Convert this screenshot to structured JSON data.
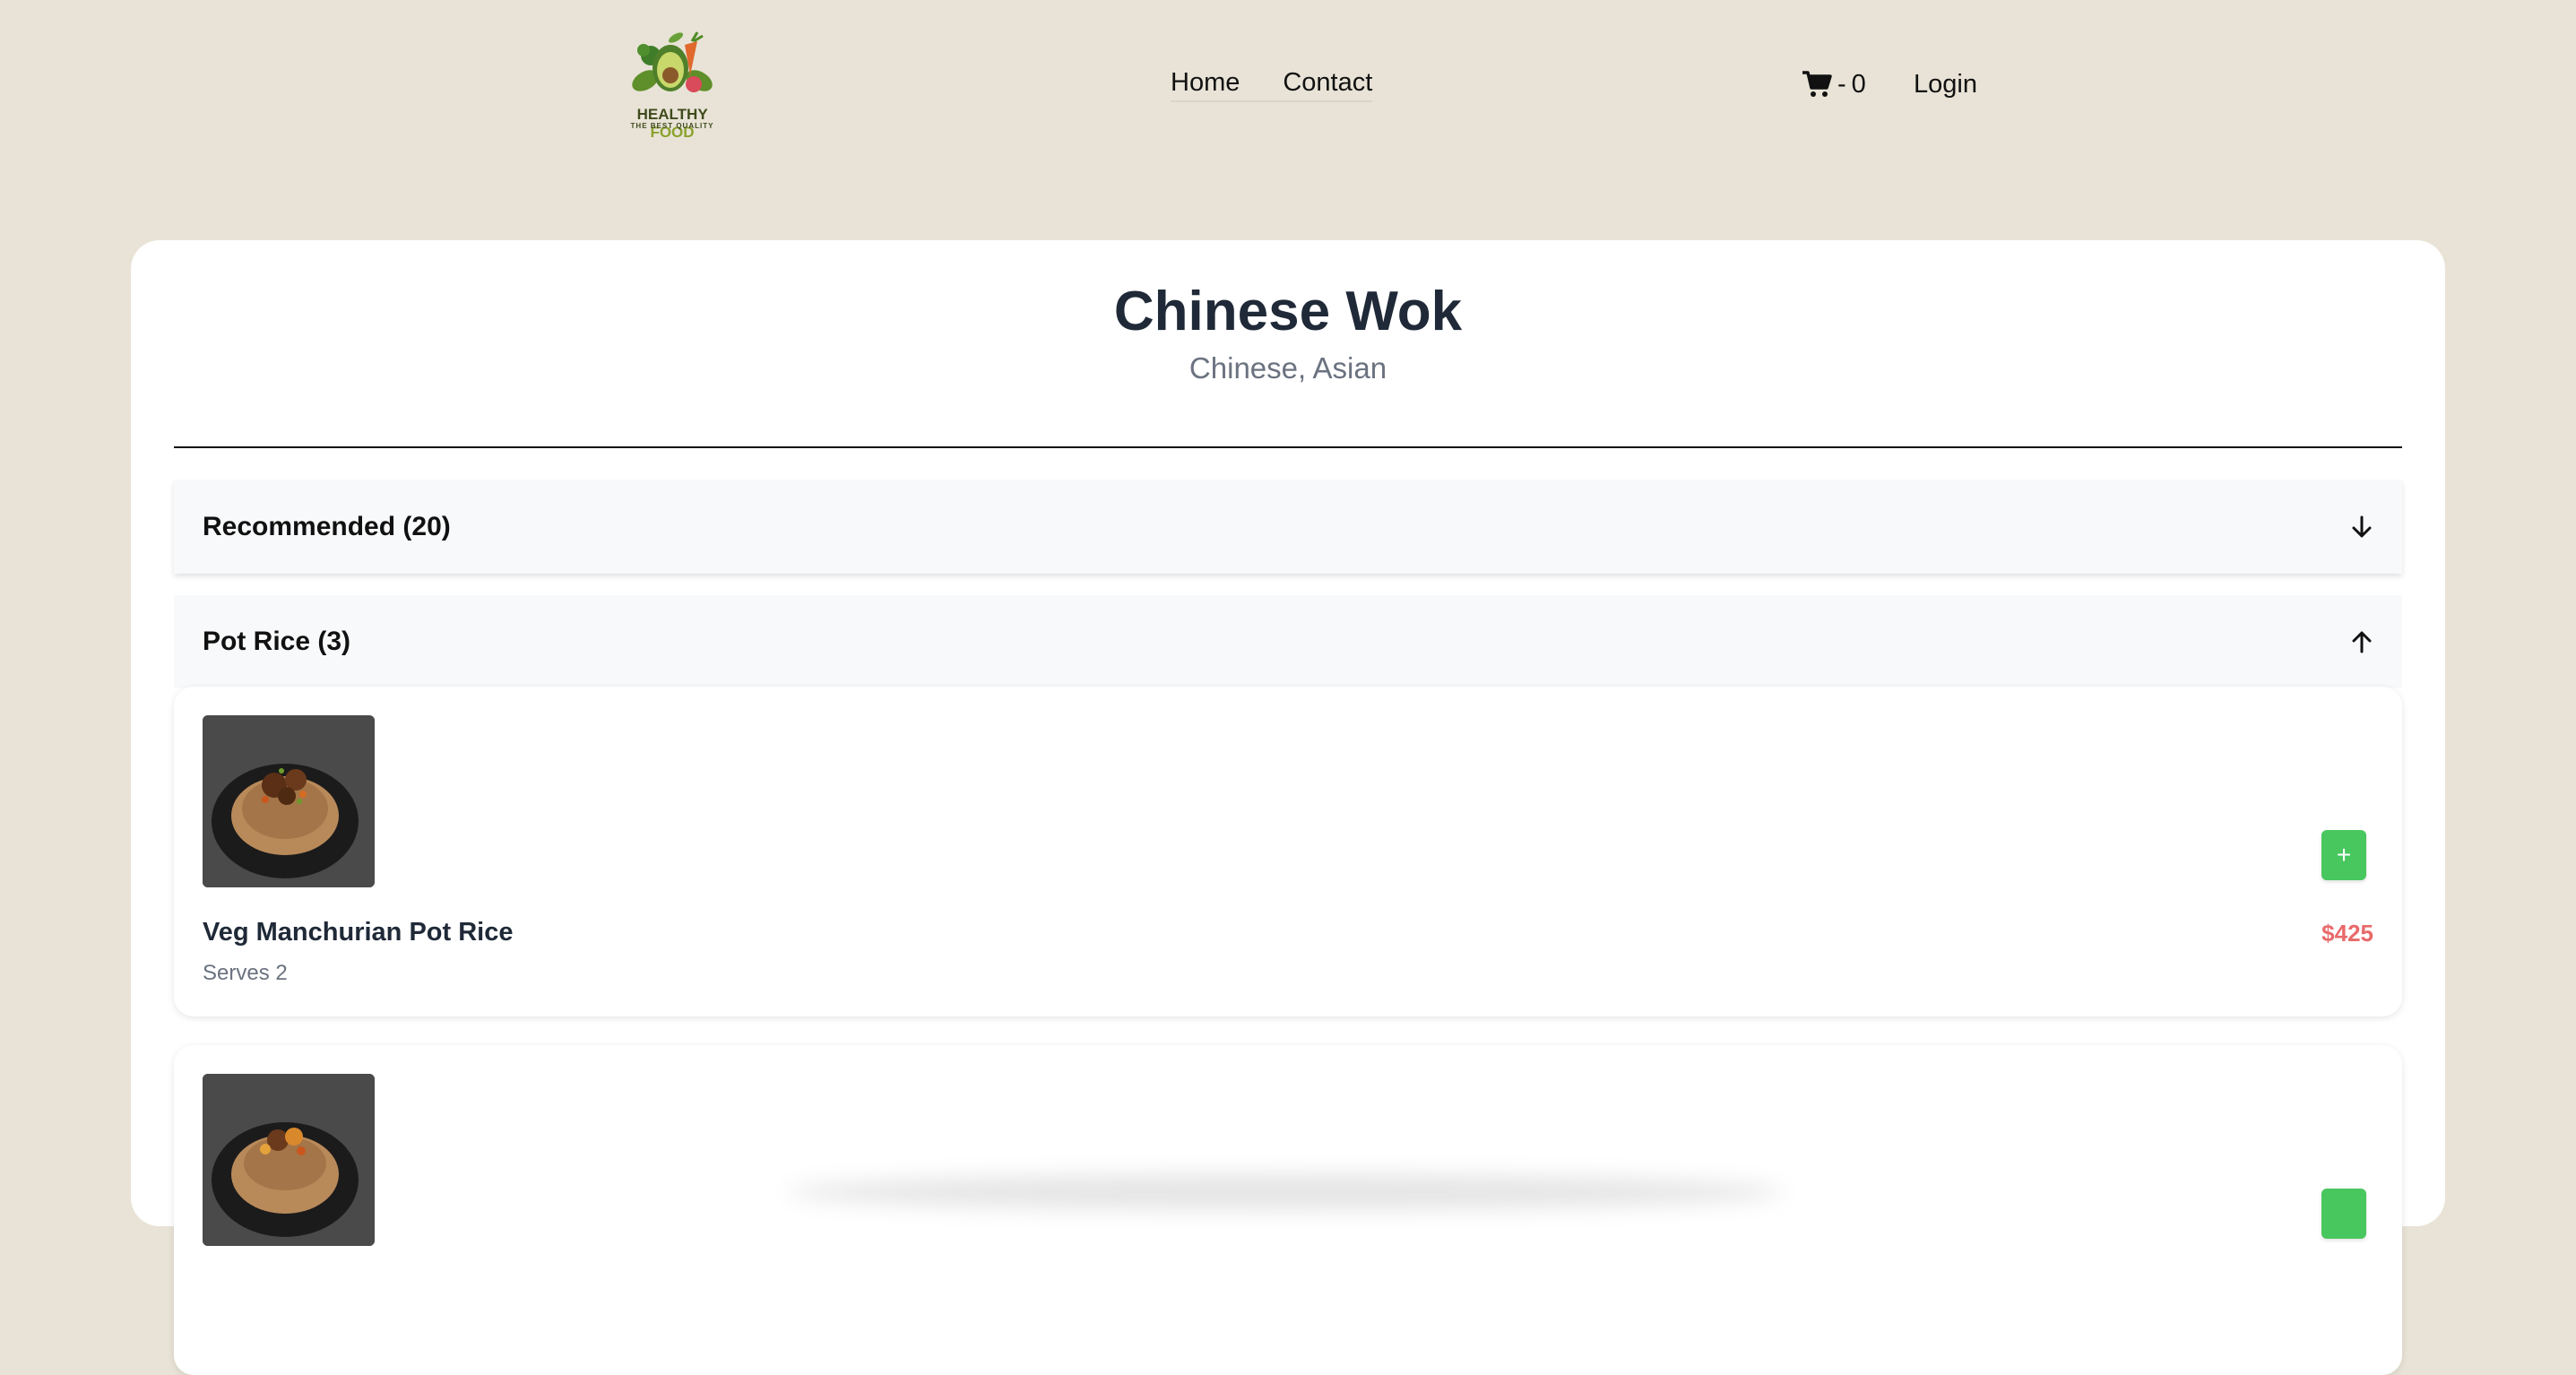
{
  "header": {
    "logo": {
      "title_main": "HEALTHY",
      "title_accent": "FOOD",
      "subtitle": "THE BEST QUALITY"
    },
    "nav": [
      {
        "label": "Home"
      },
      {
        "label": "Contact"
      }
    ],
    "cart": {
      "icon": "cart-icon",
      "separator": "-",
      "count": "0"
    },
    "login_label": "Login"
  },
  "restaurant": {
    "name": "Chinese Wok",
    "cuisine": "Chinese, Asian"
  },
  "sections": [
    {
      "title": "Recommended (20)",
      "icon": "arrow-down-icon",
      "expanded": false
    },
    {
      "title": "Pot Rice (3)",
      "icon": "arrow-up-icon",
      "expanded": true
    }
  ],
  "items": [
    {
      "name": "Veg Manchurian Pot Rice",
      "serves": "Serves 2",
      "price": "$425",
      "add_label": "+"
    },
    {
      "name": "",
      "serves": "",
      "price": "",
      "add_label": ""
    }
  ],
  "colors": {
    "background": "#e8e3d6",
    "add_button": "#48c75e",
    "price": "#e86a6a",
    "title": "#1f2937",
    "muted": "#6b7280"
  }
}
